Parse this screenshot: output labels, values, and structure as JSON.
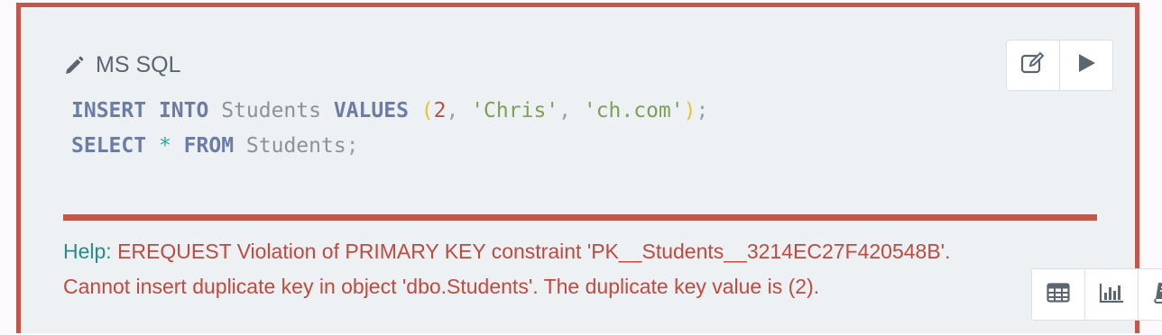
{
  "cell": {
    "language_label": "MS SQL",
    "code_lines": [
      [
        {
          "t": "INSERT",
          "c": "kw"
        },
        {
          "t": " ",
          "c": "pn"
        },
        {
          "t": "INTO",
          "c": "kw"
        },
        {
          "t": " Students ",
          "c": "id"
        },
        {
          "t": "VALUES",
          "c": "kw"
        },
        {
          "t": " ",
          "c": "pn"
        },
        {
          "t": "(",
          "c": "paren"
        },
        {
          "t": "2",
          "c": "num"
        },
        {
          "t": ", ",
          "c": "pn"
        },
        {
          "t": "'Chris'",
          "c": "str"
        },
        {
          "t": ", ",
          "c": "pn"
        },
        {
          "t": "'ch.com'",
          "c": "str"
        },
        {
          "t": ")",
          "c": "paren"
        },
        {
          "t": ";",
          "c": "pn"
        }
      ],
      [
        {
          "t": "SELECT",
          "c": "kw"
        },
        {
          "t": " ",
          "c": "pn"
        },
        {
          "t": "*",
          "c": "op"
        },
        {
          "t": " ",
          "c": "pn"
        },
        {
          "t": "FROM",
          "c": "kw"
        },
        {
          "t": " Students",
          "c": "id"
        },
        {
          "t": ";",
          "c": "pn"
        }
      ]
    ],
    "toolbar_top": {
      "buttons": [
        {
          "name": "edit-button",
          "icon": "edit-icon"
        },
        {
          "name": "run-button",
          "icon": "play-icon"
        }
      ]
    },
    "error": {
      "help_label": "Help:",
      "message_line1": "EREQUEST Violation of PRIMARY KEY constraint 'PK__Students__3214EC27F420548B'.",
      "message_line2": "Cannot insert duplicate key in object 'dbo.Students'. The duplicate key value is (2)."
    },
    "toolbar_bottom": {
      "buttons": [
        {
          "name": "table-view-button",
          "icon": "table-icon"
        },
        {
          "name": "chart-view-button",
          "icon": "bar-chart-icon"
        },
        {
          "name": "book-button",
          "icon": "book-icon"
        }
      ]
    },
    "colors": {
      "frame_border": "#c0574a",
      "background": "#edf1f3",
      "keyword": "#6b7da6",
      "string": "#7d9f56",
      "number": "#c0504a",
      "help": "#2a8a89",
      "error": "#bf4a3f",
      "icon": "#5b6670"
    }
  }
}
